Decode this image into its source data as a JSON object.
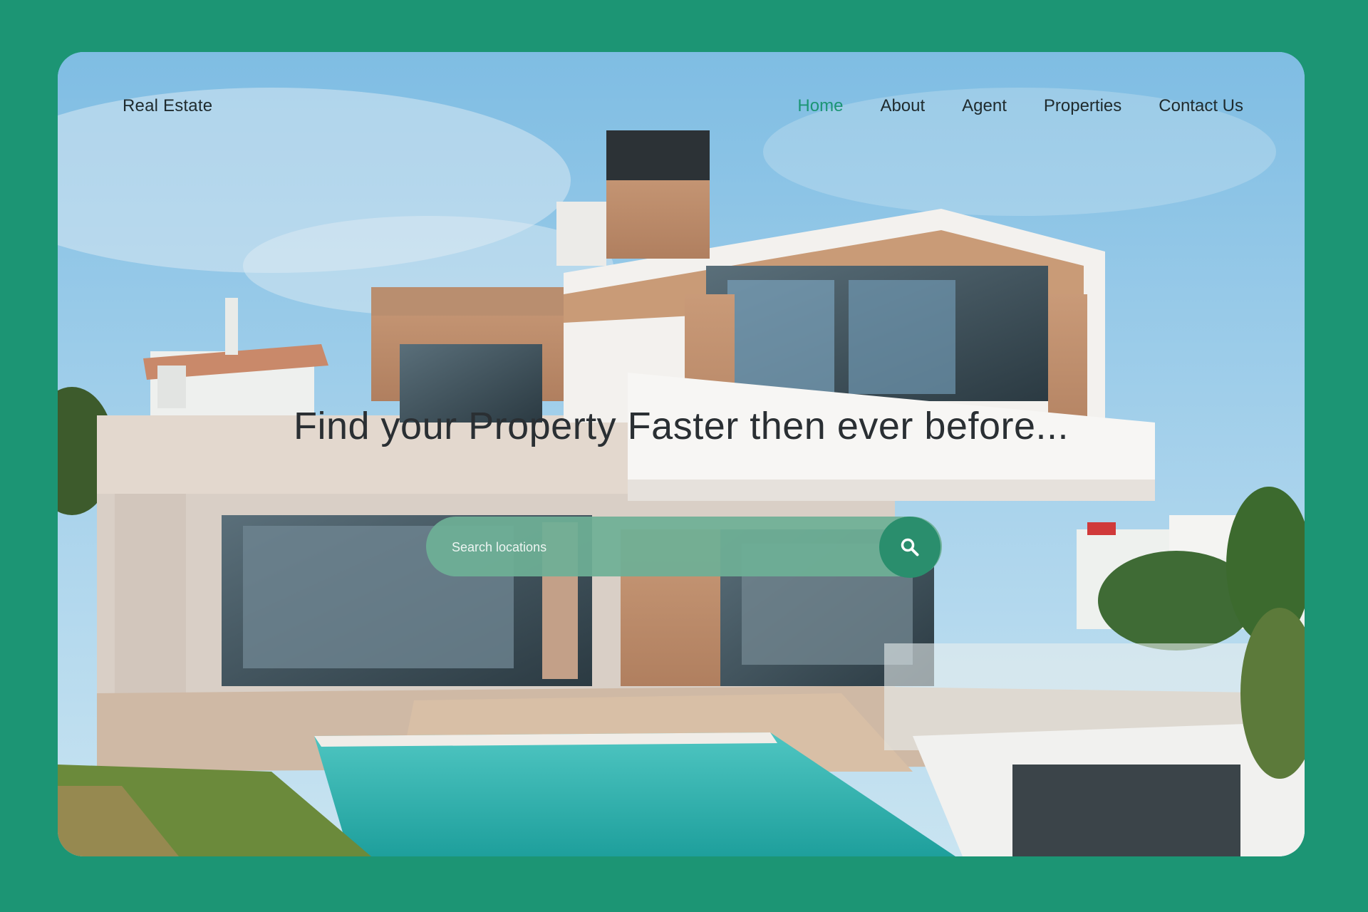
{
  "colors": {
    "page_background": "#1c9574",
    "accent": "#1c9574",
    "nav_text": "#1f2b2e",
    "headline_text": "#2a2f33",
    "search_bar": "#6eaf96",
    "search_button": "#2a8e6d"
  },
  "header": {
    "brand": "Real Estate",
    "nav": [
      {
        "label": "Home",
        "active": true
      },
      {
        "label": "About",
        "active": false
      },
      {
        "label": "Agent",
        "active": false
      },
      {
        "label": "Properties",
        "active": false
      },
      {
        "label": "Contact Us",
        "active": false
      }
    ]
  },
  "hero": {
    "headline": "Find your Property Faster then ever before...",
    "background": "modern-villa-with-pool-photo",
    "search": {
      "placeholder": "Search locations",
      "value": "",
      "button_icon": "search-icon"
    }
  }
}
